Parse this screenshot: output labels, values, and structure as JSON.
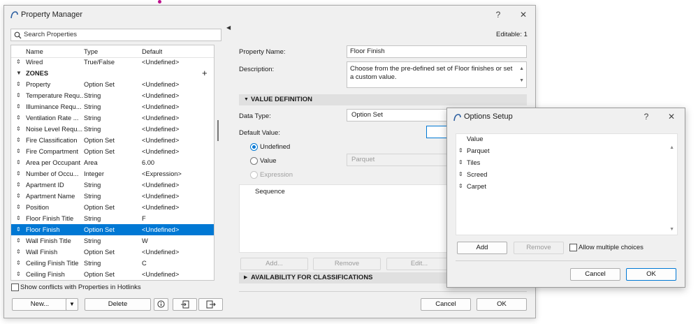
{
  "window": {
    "title": "Property Manager",
    "help": "?",
    "close": "✕"
  },
  "left": {
    "search_placeholder": "Search Properties",
    "columns": [
      "Name",
      "Type",
      "Default"
    ],
    "rows": [
      {
        "name": "Wired",
        "type": "True/False",
        "default": "<Undefined>"
      },
      {
        "name": "Property",
        "type": "Option Set",
        "default": "<Undefined>"
      },
      {
        "name": "Temperature Requ...",
        "type": "String",
        "default": "<Undefined>"
      },
      {
        "name": "Illuminance Requ...",
        "type": "String",
        "default": "<Undefined>"
      },
      {
        "name": "Ventilation Rate ...",
        "type": "String",
        "default": "<Undefined>"
      },
      {
        "name": "Noise Level Requ...",
        "type": "String",
        "default": "<Undefined>"
      },
      {
        "name": "Fire Classification",
        "type": "Option Set",
        "default": "<Undefined>"
      },
      {
        "name": "Fire Compartment",
        "type": "Option Set",
        "default": "<Undefined>"
      },
      {
        "name": "Area per Occupant",
        "type": "Area",
        "default": "6.00"
      },
      {
        "name": "Number of Occu...",
        "type": "Integer",
        "default": "<Expression>"
      },
      {
        "name": "Apartment ID",
        "type": "String",
        "default": "<Undefined>"
      },
      {
        "name": "Apartment Name",
        "type": "String",
        "default": "<Undefined>"
      },
      {
        "name": "Position",
        "type": "Option Set",
        "default": "<Undefined>"
      },
      {
        "name": "Floor Finish Title",
        "type": "String",
        "default": "F"
      },
      {
        "name": "Floor Finish",
        "type": "Option Set",
        "default": "<Undefined>"
      },
      {
        "name": "Wall Finish Title",
        "type": "String",
        "default": "W"
      },
      {
        "name": "Wall Finish",
        "type": "Option Set",
        "default": "<Undefined>"
      },
      {
        "name": "Ceiling Finish Title",
        "type": "String",
        "default": "C"
      },
      {
        "name": "Ceiling Finish",
        "type": "Option Set",
        "default": "<Undefined>"
      }
    ],
    "group_label": "ZONES",
    "show_conflicts_label": "Show conflicts with Properties in Hotlinks",
    "new_label": "New...",
    "delete_label": "Delete"
  },
  "right": {
    "editable": "Editable: 1",
    "property_name_label": "Property Name:",
    "property_name_value": "Floor Finish",
    "description_label": "Description:",
    "description_value": "Choose from the pre-defined set of Floor finishes or set a custom value.",
    "value_definition": "VALUE DEFINITION",
    "data_type_label": "Data Type:",
    "data_type_value": "Option Set",
    "default_value_label": "Default Value:",
    "radio_undefined": "Undefined",
    "radio_value": "Value",
    "value_field": "Parquet",
    "radio_expression": "Expression",
    "sequence_header": "Sequence",
    "add_label": "Add...",
    "remove_label": "Remove",
    "edit_label": "Edit...",
    "availability": "AVAILABILITY FOR CLASSIFICATIONS",
    "cancel_label": "Cancel",
    "ok_label": "OK"
  },
  "options_dialog": {
    "title": "Options Setup",
    "help": "?",
    "close": "✕",
    "header": "Value",
    "items": [
      "Parquet",
      "Tiles",
      "Screed",
      "Carpet"
    ],
    "add_label": "Add",
    "remove_label": "Remove",
    "allow_multiple": "Allow multiple choices",
    "cancel_label": "Cancel",
    "ok_label": "OK"
  },
  "colors": {
    "accent": "#0078d4",
    "selection": "#0078d4",
    "section_bg": "#e0e0e0"
  }
}
